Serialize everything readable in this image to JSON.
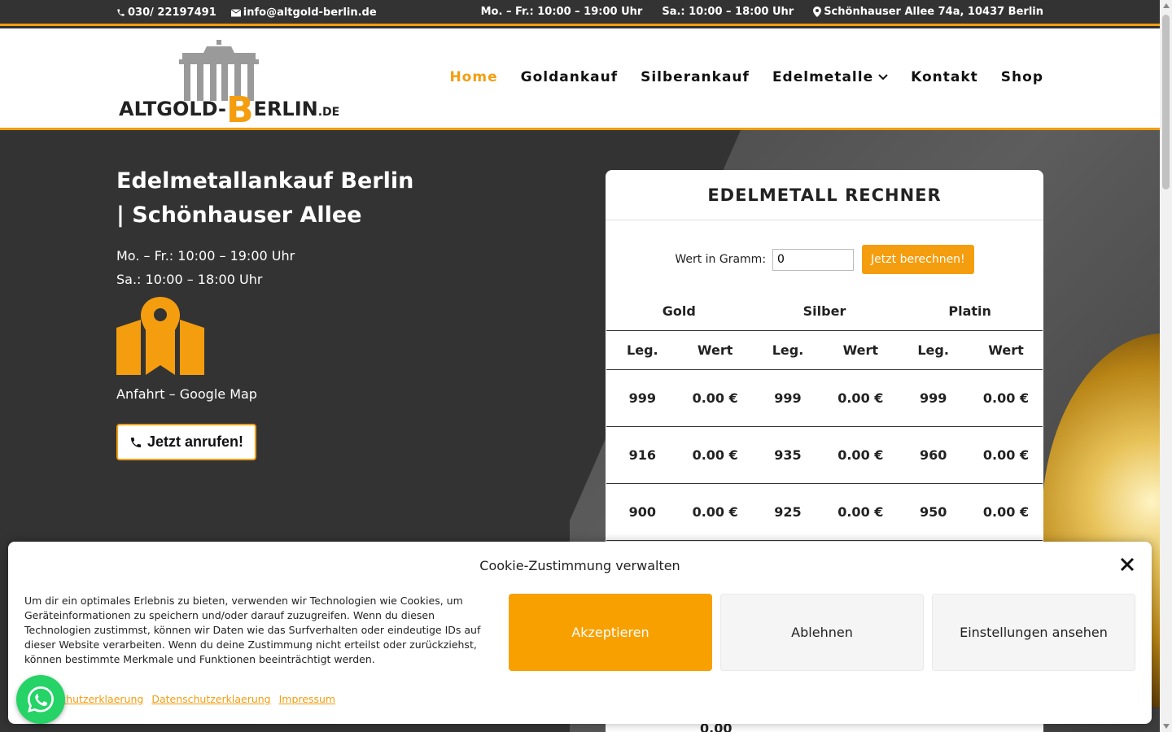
{
  "topbar": {
    "phone": "030/ 22197491",
    "email": "info@altgold-berlin.de",
    "hours_weekday": "Mo. – Fr.: 10:00 – 19:00 Uhr",
    "hours_saturday": "Sa.: 10:00 – 18:00 Uhr",
    "address": "Schönhauser Allee 74a, 10437 Berlin"
  },
  "logo": {
    "part1": "ALTGOLD-",
    "b": "B",
    "part2": "ERLIN",
    "tld": ".DE"
  },
  "nav": {
    "items": [
      {
        "label": "Home",
        "active": true
      },
      {
        "label": "Goldankauf"
      },
      {
        "label": "Silberankauf"
      },
      {
        "label": "Edelmetalle",
        "has_dropdown": true
      },
      {
        "label": "Kontakt"
      },
      {
        "label": "Shop"
      }
    ]
  },
  "hero": {
    "title_line1": "Edelmetallankauf Berlin",
    "title_line2": "| Schönhauser Allee",
    "hours_weekday": "Mo. – Fr.: 10:00 – 19:00 Uhr",
    "hours_saturday": "Sa.: 10:00 – 18:00 Uhr",
    "map_label": "Anfahrt – Google Map",
    "call_button": "Jetzt anrufen!"
  },
  "calculator": {
    "title": "EDELMETALL RECHNER",
    "input_label": "Wert in Gramm:",
    "input_value": "0",
    "submit_label": "Jetzt berechnen!",
    "metals": [
      "Gold",
      "Silber",
      "Platin"
    ],
    "sub_headers": [
      "Leg.",
      "Wert"
    ],
    "rows": [
      {
        "gold_leg": "999",
        "gold_val": "0.00 €",
        "silver_leg": "999",
        "silver_val": "0.00 €",
        "platin_leg": "999",
        "platin_val": "0.00 €"
      },
      {
        "gold_leg": "916",
        "gold_val": "0.00 €",
        "silver_leg": "935",
        "silver_val": "0.00 €",
        "platin_leg": "960",
        "platin_val": "0.00 €"
      },
      {
        "gold_leg": "900",
        "gold_val": "0.00 €",
        "silver_leg": "925",
        "silver_val": "0.00 €",
        "platin_leg": "950",
        "platin_val": "0.00 €"
      }
    ],
    "peek_value": "0.00"
  },
  "cookie": {
    "title": "Cookie-Zustimmung verwalten",
    "text": "Um dir ein optimales Erlebnis zu bieten, verwenden wir Technologien wie Cookies, um Geräteinformationen zu speichern und/oder darauf zuzugreifen. Wenn du diesen Technologien zustimmst, können wir Daten wie das Surfverhalten oder eindeutige IDs auf dieser Website verarbeiten. Wenn du deine Zustimmung nicht erteilst oder zurückziehst, können bestimmte Merkmale und Funktionen beeinträchtigt werden.",
    "accept": "Akzeptieren",
    "deny": "Ablehnen",
    "settings": "Einstellungen ansehen",
    "links": [
      "Datenschutzerklaerung",
      "Datenschutzerklaerung",
      "Impressum"
    ]
  },
  "colors": {
    "accent": "#f49d0f",
    "dark": "#333333",
    "whatsapp": "#25d366"
  }
}
